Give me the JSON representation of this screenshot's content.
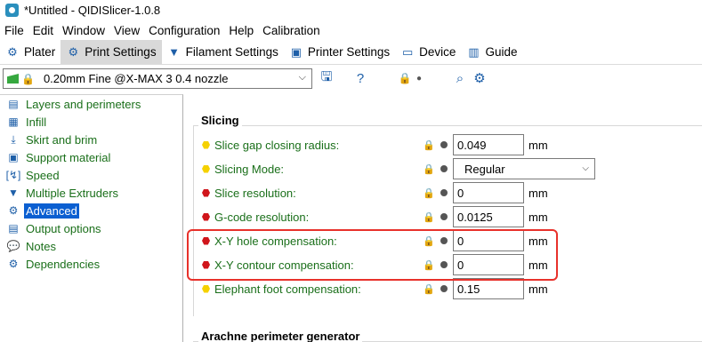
{
  "window": {
    "title": "*Untitled - QIDISlicer-1.0.8"
  },
  "menu": [
    "File",
    "Edit",
    "Window",
    "View",
    "Configuration",
    "Help",
    "Calibration"
  ],
  "tabs": [
    {
      "label": "Plater",
      "icon": "gear-cluster-icon"
    },
    {
      "label": "Print Settings",
      "icon": "gear-icon",
      "active": true
    },
    {
      "label": "Filament Settings",
      "icon": "spool-icon"
    },
    {
      "label": "Printer Settings",
      "icon": "printer-icon"
    },
    {
      "label": "Device",
      "icon": "monitor-icon"
    },
    {
      "label": "Guide",
      "icon": "books-icon"
    }
  ],
  "preset": {
    "name": "0.20mm Fine @X-MAX 3 0.4 nozzle"
  },
  "sidebar": {
    "items": [
      {
        "label": "Layers and perimeters",
        "icon": "layers-icon"
      },
      {
        "label": "Infill",
        "icon": "infill-icon"
      },
      {
        "label": "Skirt and brim",
        "icon": "skirt-icon"
      },
      {
        "label": "Support material",
        "icon": "support-icon"
      },
      {
        "label": "Speed",
        "icon": "speed-icon"
      },
      {
        "label": "Multiple Extruders",
        "icon": "extruder-icon"
      },
      {
        "label": "Advanced",
        "icon": "advanced-icon",
        "selected": true
      },
      {
        "label": "Output options",
        "icon": "output-icon"
      },
      {
        "label": "Notes",
        "icon": "notes-icon"
      },
      {
        "label": "Dependencies",
        "icon": "dependencies-icon"
      }
    ]
  },
  "main": {
    "group_title": "Slicing",
    "rows": [
      {
        "label": "Slice gap closing radius:",
        "level": "yellow",
        "value": "0.049",
        "unit": "mm",
        "type": "field"
      },
      {
        "label": "Slicing Mode:",
        "level": "yellow",
        "value": "Regular",
        "unit": "",
        "type": "select"
      },
      {
        "label": "Slice resolution:",
        "level": "red",
        "value": "0",
        "unit": "mm",
        "type": "field"
      },
      {
        "label": "G-code resolution:",
        "level": "red",
        "value": "0.0125",
        "unit": "mm",
        "type": "field"
      },
      {
        "label": "X-Y hole compensation:",
        "level": "red",
        "value": "0",
        "unit": "mm",
        "type": "field"
      },
      {
        "label": "X-Y contour compensation:",
        "level": "red",
        "value": "0",
        "unit": "mm",
        "type": "field"
      },
      {
        "label": "Elephant foot compensation:",
        "level": "yellow",
        "value": "0.15",
        "unit": "mm",
        "type": "field"
      }
    ],
    "group2_title": "Arachne perimeter generator"
  },
  "colors": {
    "accent": "#0b5fd1",
    "label_green": "#1a6f1a",
    "highlight": "#e8312b"
  }
}
